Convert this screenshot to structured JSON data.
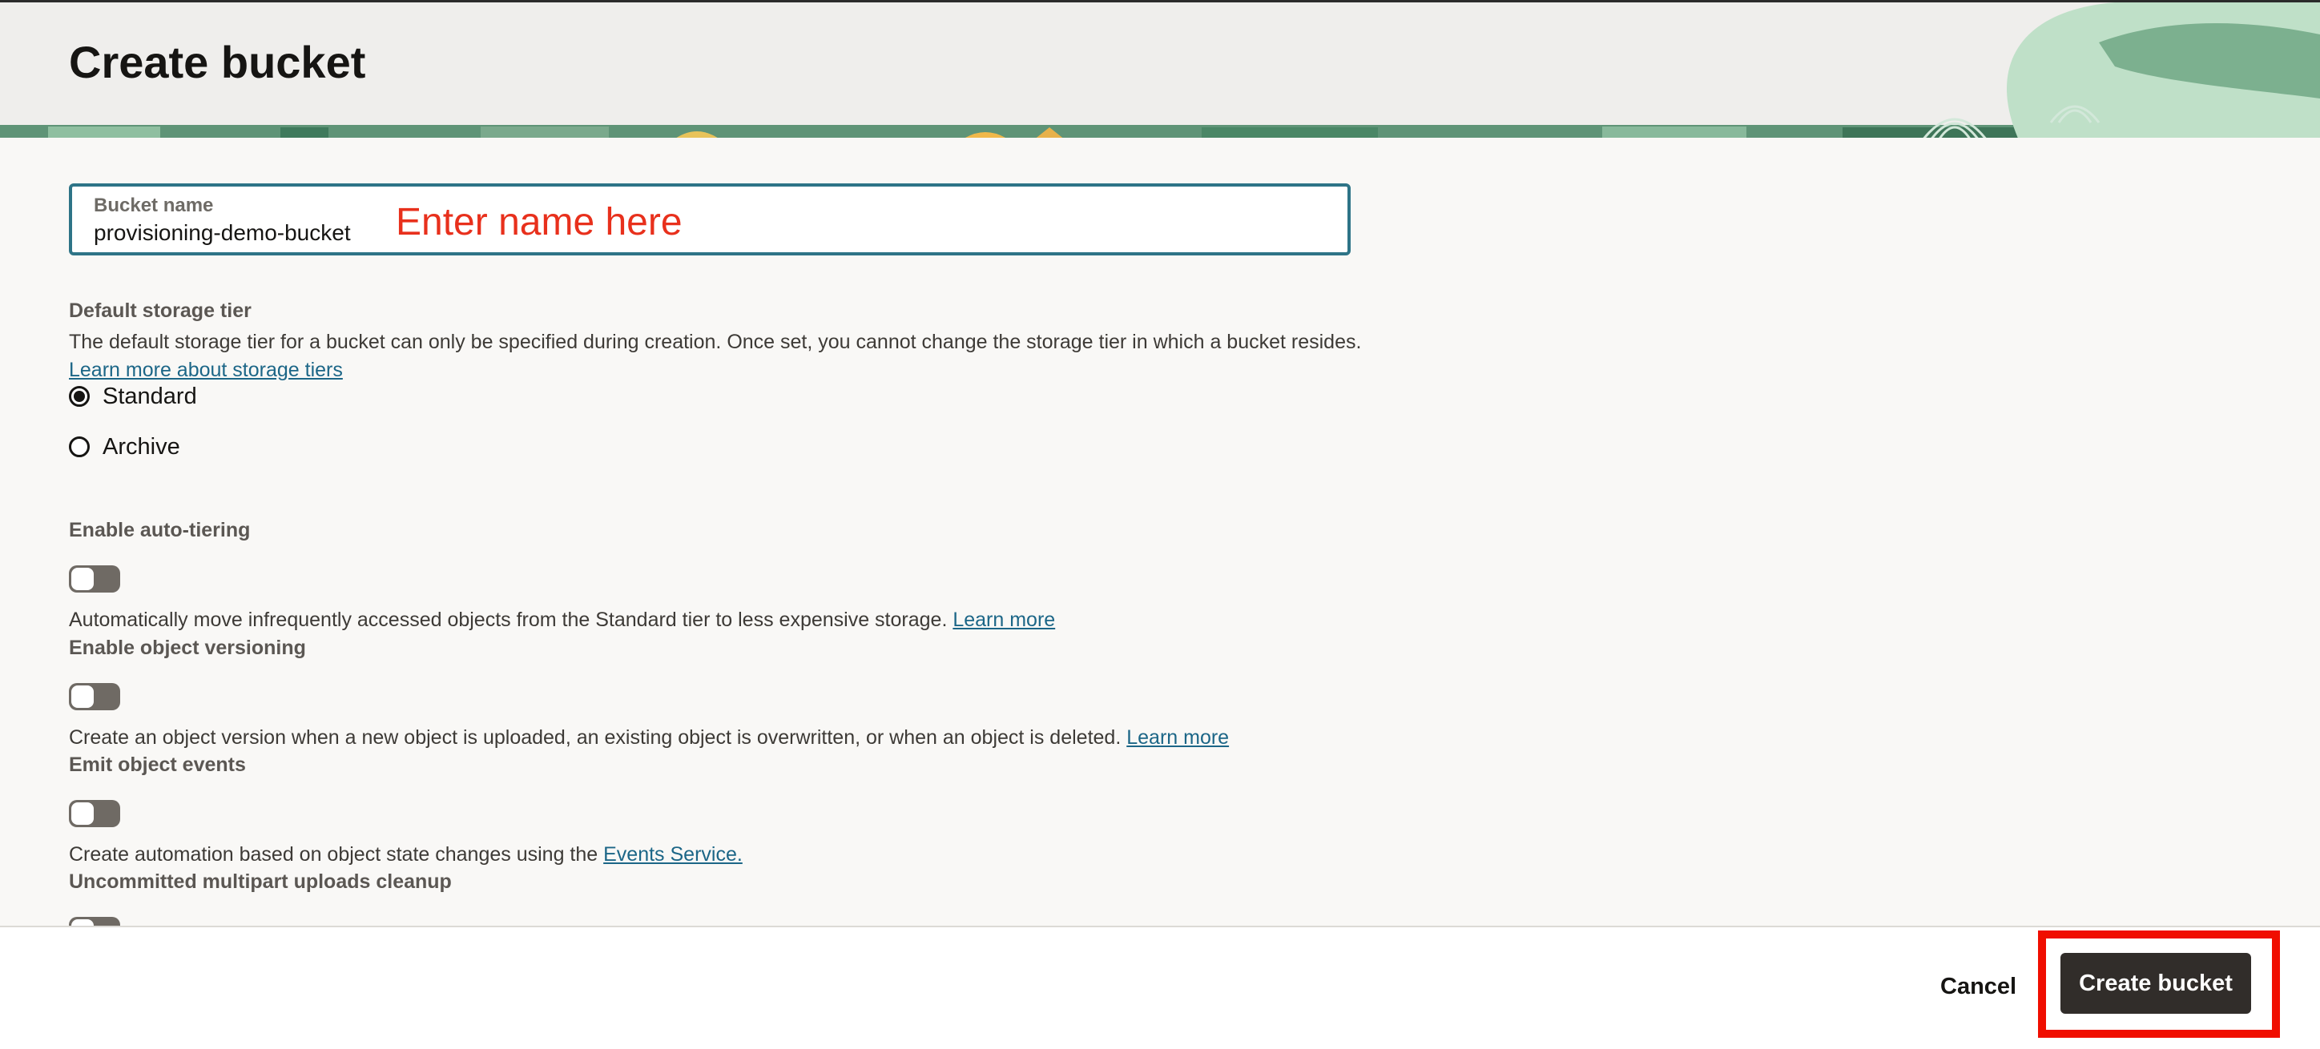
{
  "header": {
    "title": "Create bucket"
  },
  "bucket_name": {
    "label": "Bucket name",
    "value": "provisioning-demo-bucket"
  },
  "annotation": {
    "text": "Enter name here",
    "color": "#e8301c",
    "highlight_color": "#f00e00"
  },
  "storage_tier": {
    "title": "Default storage tier",
    "description": "The default storage tier for a bucket can only be specified during creation. Once set, you cannot change the storage tier in which a bucket resides.",
    "link": "Learn more about storage tiers",
    "options": [
      {
        "label": "Standard",
        "selected": true
      },
      {
        "label": "Archive",
        "selected": false
      }
    ]
  },
  "auto_tiering": {
    "title": "Enable auto-tiering",
    "enabled": false,
    "description": "Automatically move infrequently accessed objects from the Standard tier to less expensive storage.",
    "link": "Learn more"
  },
  "versioning": {
    "title": "Enable object versioning",
    "enabled": false,
    "description": "Create an object version when a new object is uploaded, an existing object is overwritten, or when an object is deleted.",
    "link": "Learn more"
  },
  "object_events": {
    "title": "Emit object events",
    "enabled": false,
    "description": "Create automation based on object state changes using the",
    "link": "Events Service."
  },
  "multipart_cleanup": {
    "title": "Uncommitted multipart uploads cleanup",
    "enabled": false
  },
  "footer": {
    "cancel_label": "Cancel",
    "create_label": "Create bucket"
  },
  "colors": {
    "accent": "#2e7487",
    "link": "#1c6687",
    "primary_button": "#312d2a",
    "toggle_off": "#6f6a64"
  }
}
